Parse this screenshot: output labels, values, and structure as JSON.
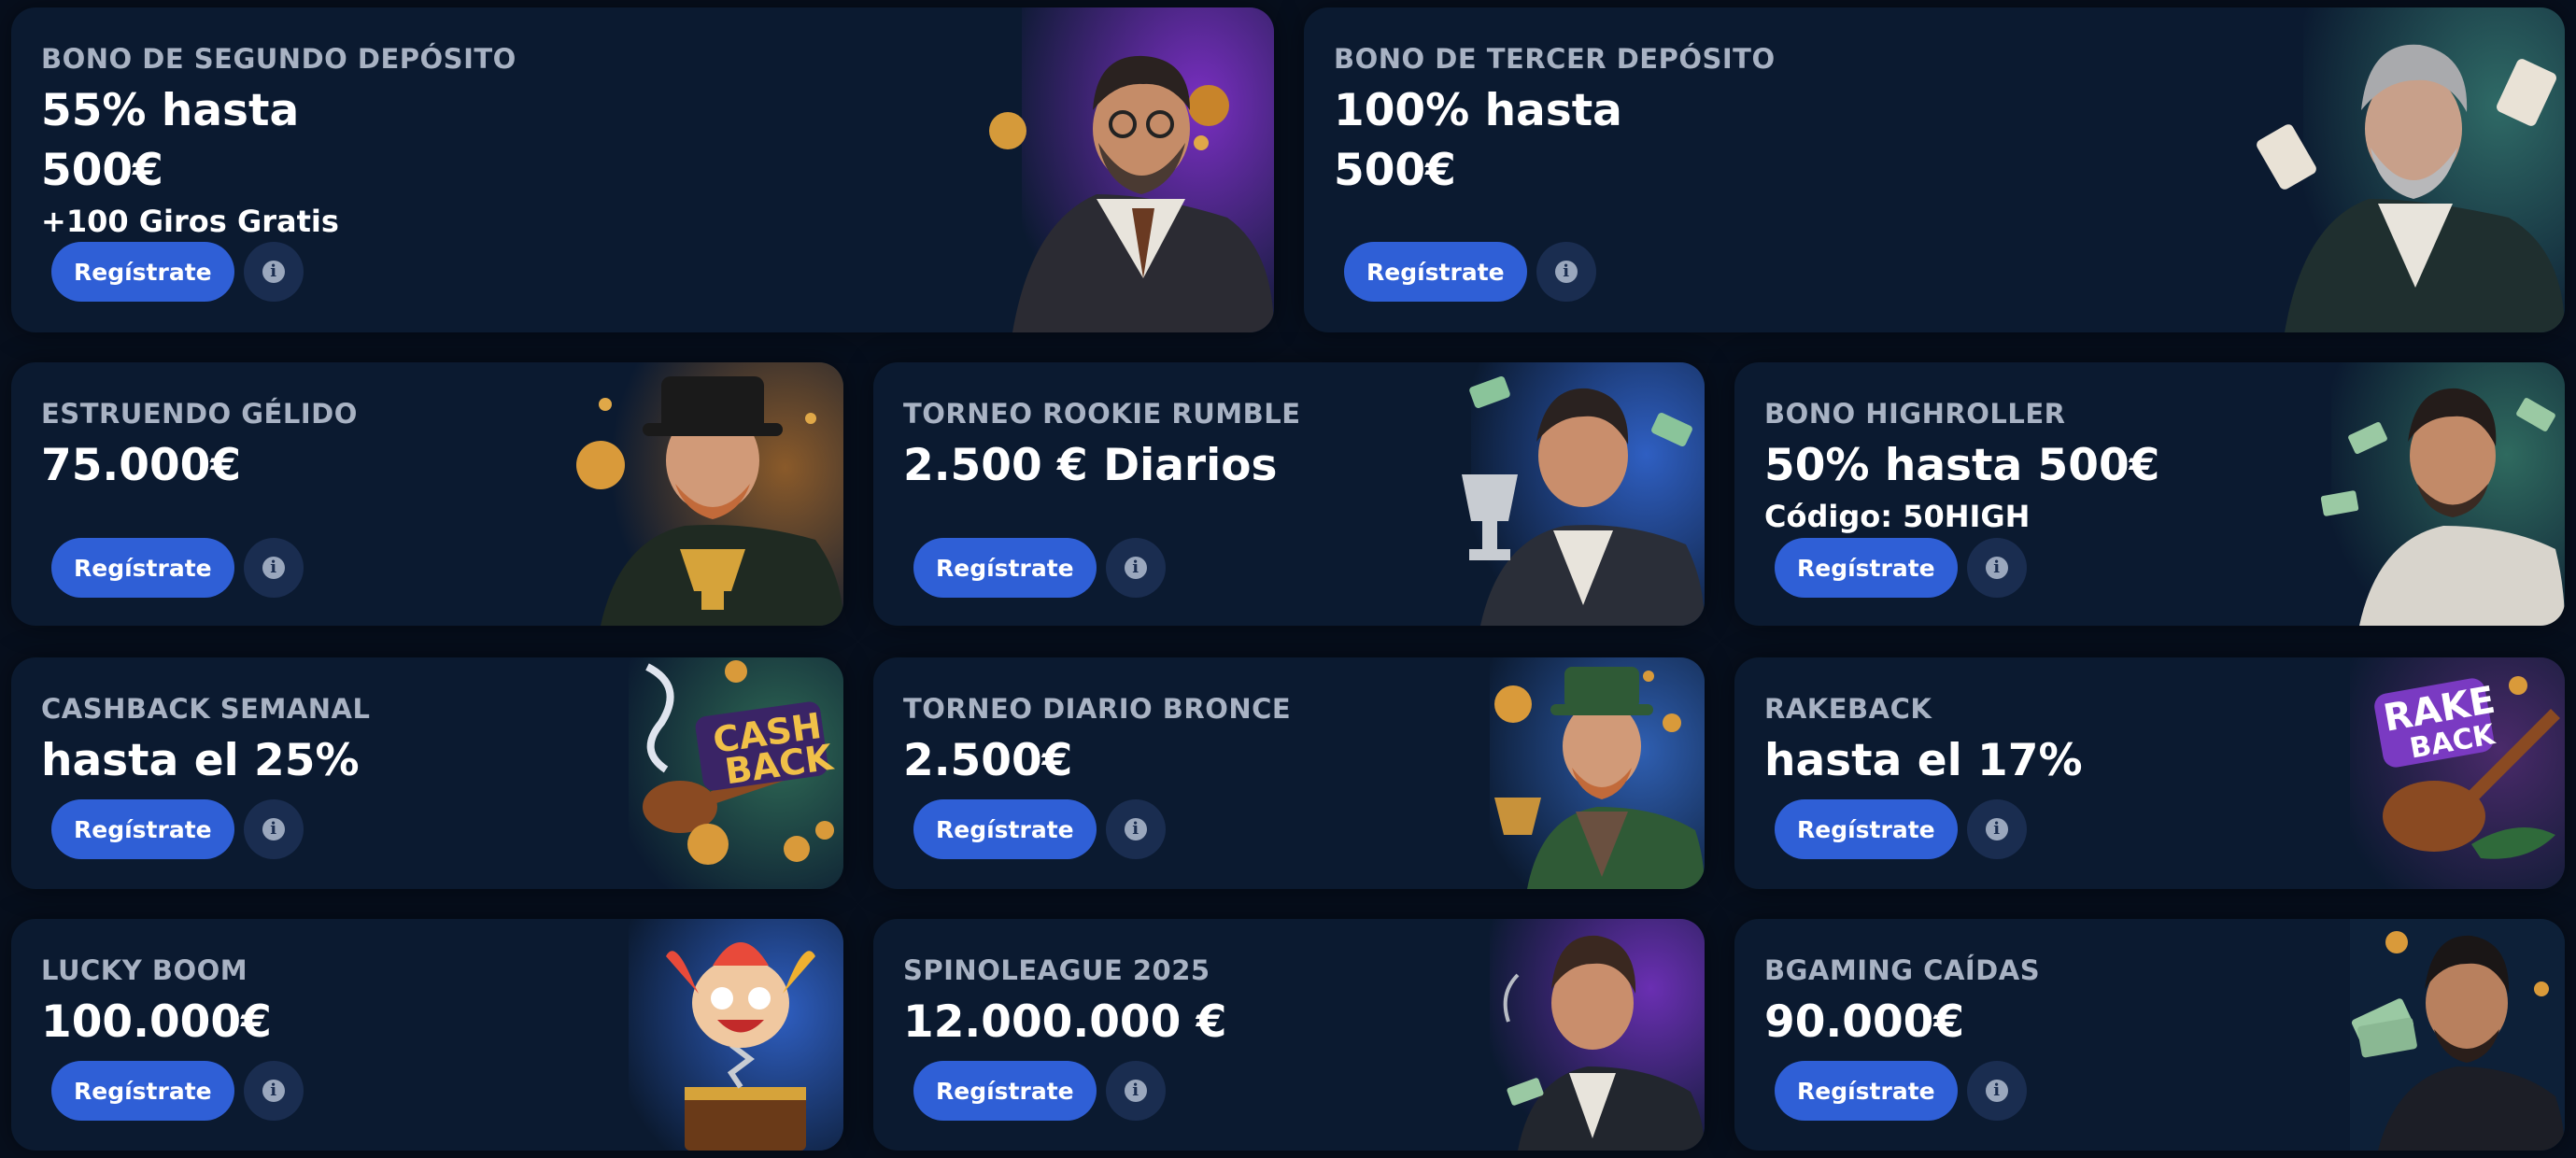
{
  "common": {
    "register_label": "Regístrate",
    "info_icon": "info-icon"
  },
  "cards": [
    {
      "title": "BONO DE SEGUNDO DEPÓSITO",
      "value": "55% hasta",
      "value2": "500€",
      "sub": "+100 Giros Gratis",
      "art": "gentleman-with-coins",
      "accent": "#4a1f7a"
    },
    {
      "title": "BONO DE TERCER DEPÓSITO",
      "value": "100% hasta",
      "value2": "500€",
      "art": "gentleman-with-cards",
      "accent": "#1f4a4a"
    },
    {
      "title": "ESTRUENDO GÉLIDO",
      "value": "75.000€",
      "art": "leprechaun-with-trophy",
      "accent": "#6a3a1a"
    },
    {
      "title": "TORNEO ROOKIE RUMBLE",
      "value": "2.500 € Diarios",
      "art": "gentleman-with-trophy",
      "accent": "#1f3a8a"
    },
    {
      "title": "BONO HIGHROLLER",
      "value": "50% hasta 500€",
      "sub": "Código: 50HIGH",
      "art": "man-with-money",
      "accent": "#1a4a4a"
    },
    {
      "title": "CASHBACK SEMANAL",
      "value": "hasta el 25%",
      "art": "cashback-logo",
      "accent": "#1a4a40"
    },
    {
      "title": "TORNEO DIARIO BRONCE",
      "value": "2.500€",
      "art": "leprechaun-with-cup",
      "accent": "#1f3a7a"
    },
    {
      "title": "RAKEBACK",
      "value": "hasta el 17%",
      "art": "rakeback-logo",
      "accent": "#3a1a5a"
    },
    {
      "title": "LUCKY BOOM",
      "value": "100.000€",
      "art": "jester-in-box",
      "accent": "#1f3a8a"
    },
    {
      "title": "SPINOLEAGUE 2025",
      "value": "12.000.000 €",
      "art": "gentleman-with-cigar",
      "accent": "#4a1f7a"
    },
    {
      "title": "BGAMING CAÍDAS",
      "value": "90.000€",
      "art": "man-with-cash",
      "accent": "#0f2540"
    }
  ]
}
